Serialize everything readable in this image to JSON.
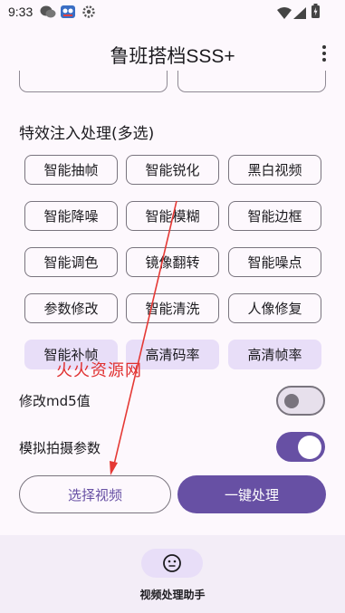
{
  "status_bar": {
    "time": "9:33",
    "icons": [
      "chat-app-icon",
      "game-app-icon",
      "settings-gear-icon",
      "wifi-icon",
      "signal-icon",
      "battery-icon"
    ]
  },
  "app_bar": {
    "title": "鲁班搭档SSS+",
    "menu_icon": "more-vert-icon"
  },
  "effects": {
    "title": "特效注入处理(多选)",
    "options": [
      {
        "label": "智能抽帧",
        "selected": false
      },
      {
        "label": "智能锐化",
        "selected": false
      },
      {
        "label": "黑白视频",
        "selected": false
      },
      {
        "label": "智能降噪",
        "selected": false
      },
      {
        "label": "智能模糊",
        "selected": false
      },
      {
        "label": "智能边框",
        "selected": false
      },
      {
        "label": "智能调色",
        "selected": false
      },
      {
        "label": "镜像翻转",
        "selected": false
      },
      {
        "label": "智能噪点",
        "selected": false
      },
      {
        "label": "参数修改",
        "selected": false
      },
      {
        "label": "智能清洗",
        "selected": false
      },
      {
        "label": "人像修复",
        "selected": false
      },
      {
        "label": "智能补帧",
        "selected": true
      },
      {
        "label": "高清码率",
        "selected": true
      },
      {
        "label": "高清帧率",
        "selected": true
      }
    ]
  },
  "settings": {
    "md5_label": "修改md5值",
    "md5_on": false,
    "camera_label": "模拟拍摄参数",
    "camera_on": true
  },
  "actions": {
    "select_video": "选择视频",
    "one_click_process": "一键处理"
  },
  "bottom_nav": {
    "item_label": "视频处理助手",
    "item_icon": "smiley-face-icon"
  },
  "watermark": "火火资源网",
  "colors": {
    "primary": "#6750a4",
    "primary_container": "#e8def8",
    "annotation_red": "#e53935",
    "watermark_red": "#e03030"
  }
}
